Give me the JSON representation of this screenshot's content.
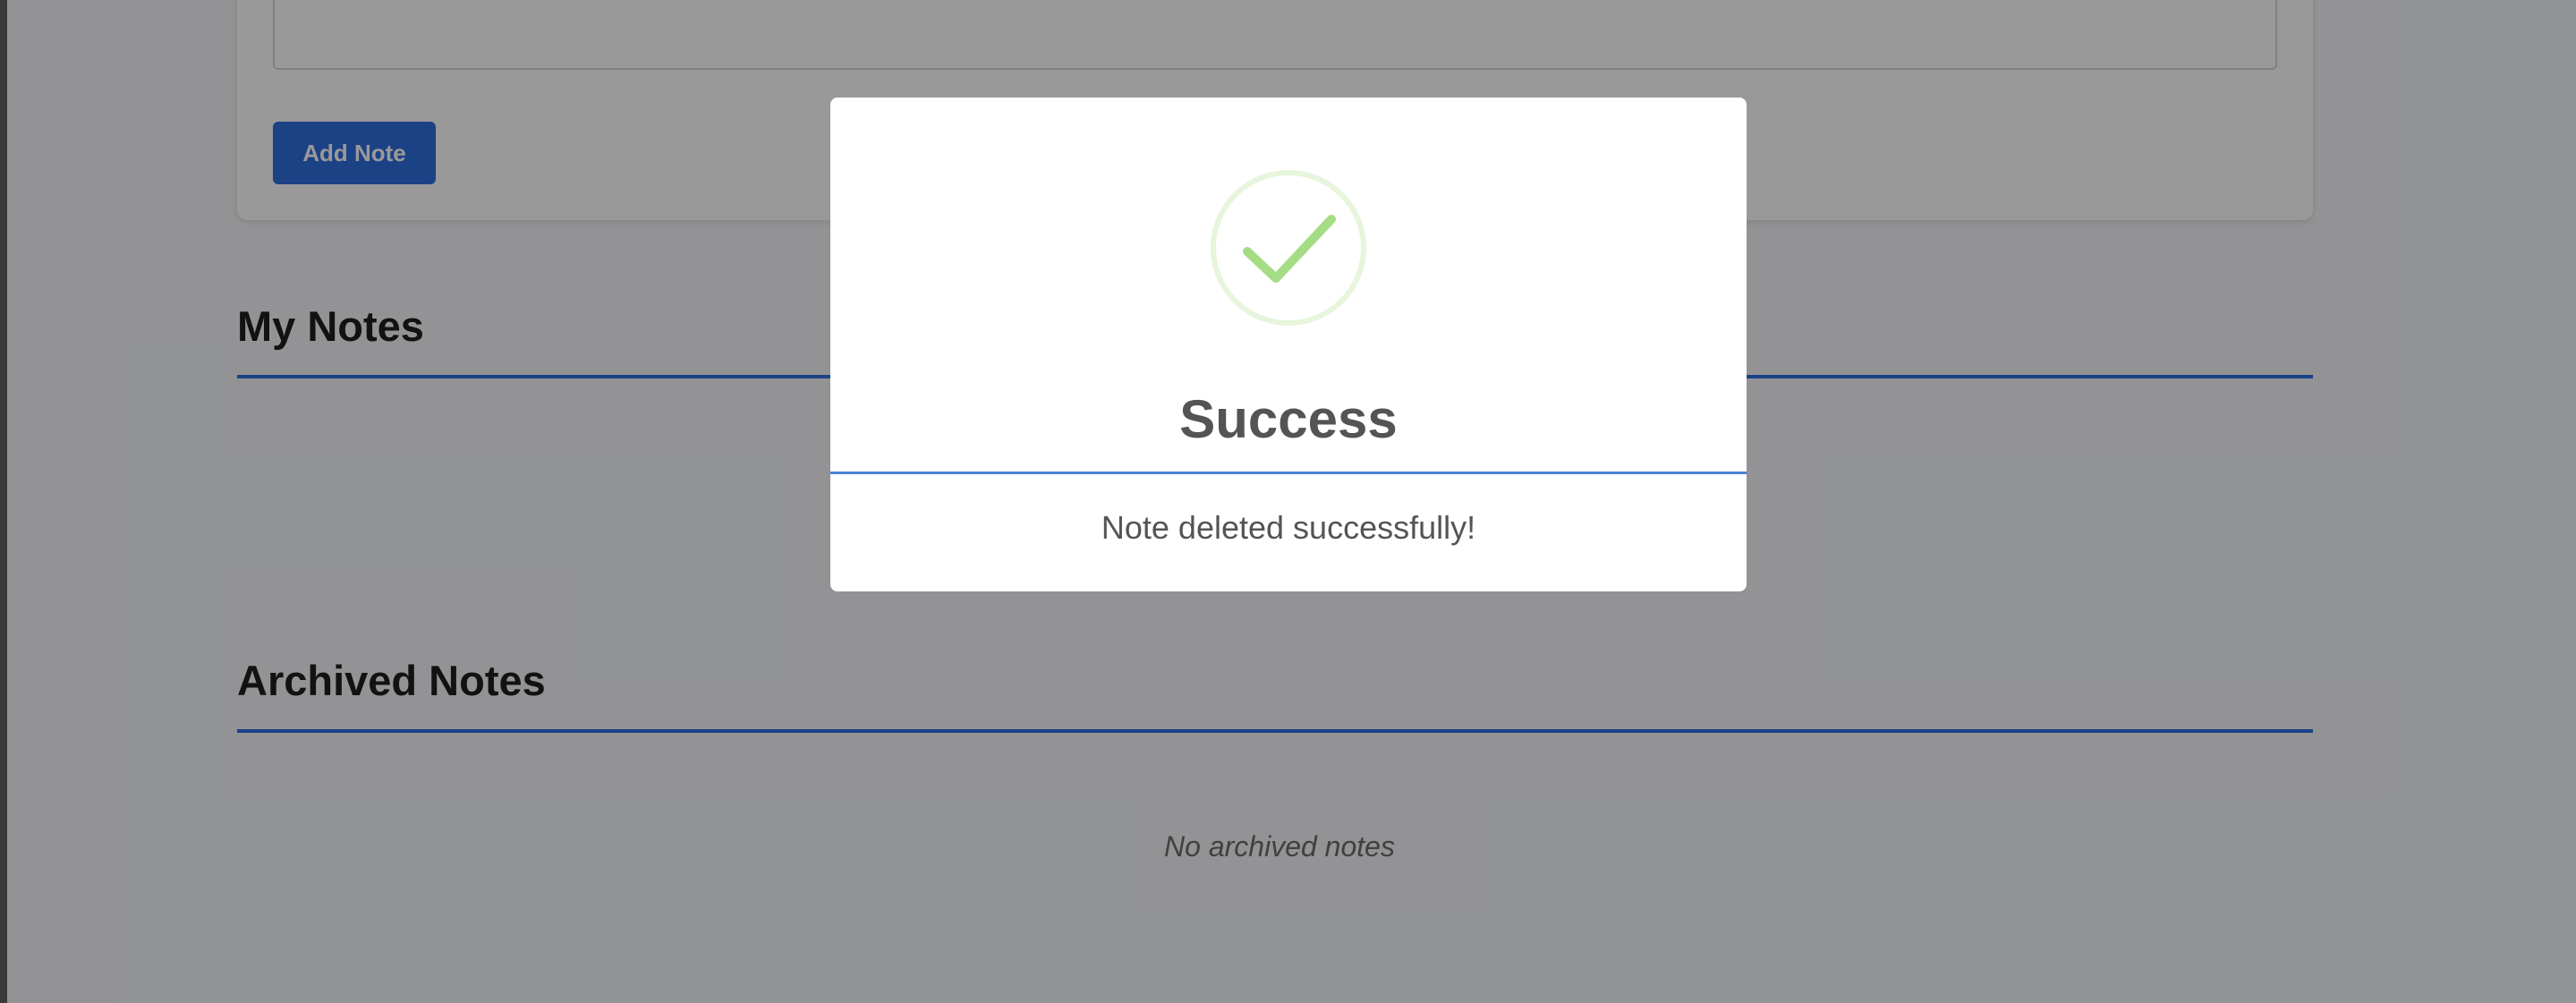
{
  "form": {
    "add_note_label": "Add Note"
  },
  "sections": {
    "my_notes_title": "My Notes",
    "archived_title": "Archived Notes",
    "archived_empty": "No archived notes"
  },
  "modal": {
    "icon": "success-checkmark-icon",
    "title": "Success",
    "message": "Note deleted successfully!"
  },
  "colors": {
    "accent": "#2f6fe0",
    "success": "#a5dc86",
    "success_ring": "#e6f5dc",
    "overlay": "rgba(0,0,0,0.4)"
  }
}
